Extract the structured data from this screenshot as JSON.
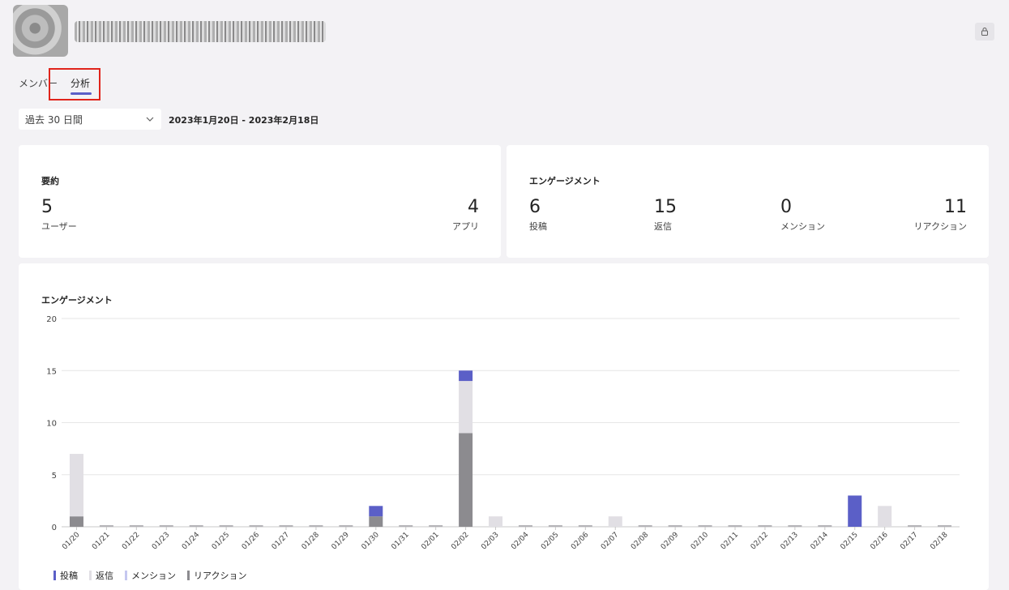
{
  "tabs": [
    {
      "label": "メンバー"
    },
    {
      "label": "分析"
    }
  ],
  "filter": {
    "selected": "過去 30 日間",
    "range_text": "2023年1月20日 - 2023年2月18日"
  },
  "summary": {
    "title": "要約",
    "users": {
      "value": "5",
      "label": "ユーザー"
    },
    "apps": {
      "value": "4",
      "label": "アプリ"
    }
  },
  "engagement_summary": {
    "title": "エンゲージメント",
    "stats": [
      {
        "value": "6",
        "label": "投稿"
      },
      {
        "value": "15",
        "label": "返信"
      },
      {
        "value": "0",
        "label": "メンション"
      },
      {
        "value": "11",
        "label": "リアクション"
      }
    ]
  },
  "chart_section": {
    "title": "エンゲージメント"
  },
  "colors": {
    "posts": "#5b5fc7",
    "replies": "#e1dfe4",
    "mentions": "#c5c7f0",
    "reactions": "#8c8b8f"
  },
  "icons": {
    "corner": "lock-icon",
    "dropdown": "chevron-down-icon"
  },
  "chart_data": {
    "type": "bar",
    "stacked": true,
    "title": "エンゲージメント",
    "ylim": [
      0,
      20
    ],
    "yticks": [
      "0",
      "5",
      "10",
      "15",
      "20"
    ],
    "grid": true,
    "legend_position": "bottom-left",
    "categories": [
      "01/20",
      "01/21",
      "01/22",
      "01/23",
      "01/24",
      "01/25",
      "01/26",
      "01/27",
      "01/28",
      "01/29",
      "01/30",
      "01/31",
      "02/01",
      "02/02",
      "02/03",
      "02/04",
      "02/05",
      "02/06",
      "02/07",
      "02/08",
      "02/09",
      "02/10",
      "02/11",
      "02/12",
      "02/13",
      "02/14",
      "02/15",
      "02/16",
      "02/17",
      "02/18"
    ],
    "series": [
      {
        "name": "リアクション",
        "color": "#8c8b8f",
        "values": [
          1,
          0,
          0,
          0,
          0,
          0,
          0,
          0,
          0,
          0,
          1,
          0,
          0,
          9,
          0,
          0,
          0,
          0,
          0,
          0,
          0,
          0,
          0,
          0,
          0,
          0,
          0,
          0,
          0,
          0
        ]
      },
      {
        "name": "メンション",
        "color": "#c5c7f0",
        "values": [
          0,
          0,
          0,
          0,
          0,
          0,
          0,
          0,
          0,
          0,
          0,
          0,
          0,
          0,
          0,
          0,
          0,
          0,
          0,
          0,
          0,
          0,
          0,
          0,
          0,
          0,
          0,
          0,
          0,
          0
        ]
      },
      {
        "name": "返信",
        "color": "#e1dfe4",
        "values": [
          6,
          0,
          0,
          0,
          0,
          0,
          0,
          0,
          0,
          0,
          0,
          0,
          0,
          5,
          1,
          0,
          0,
          0,
          1,
          0,
          0,
          0,
          0,
          0,
          0,
          0,
          0,
          2,
          0,
          0
        ]
      },
      {
        "name": "投稿",
        "color": "#5b5fc7",
        "values": [
          0,
          0,
          0,
          0,
          0,
          0,
          0,
          0,
          0,
          0,
          1,
          0,
          0,
          1,
          0,
          0,
          0,
          0,
          0,
          0,
          0,
          0,
          0,
          0,
          0,
          0,
          3,
          0,
          0,
          0
        ]
      }
    ],
    "legend": [
      "投稿",
      "返信",
      "メンション",
      "リアクション"
    ]
  }
}
